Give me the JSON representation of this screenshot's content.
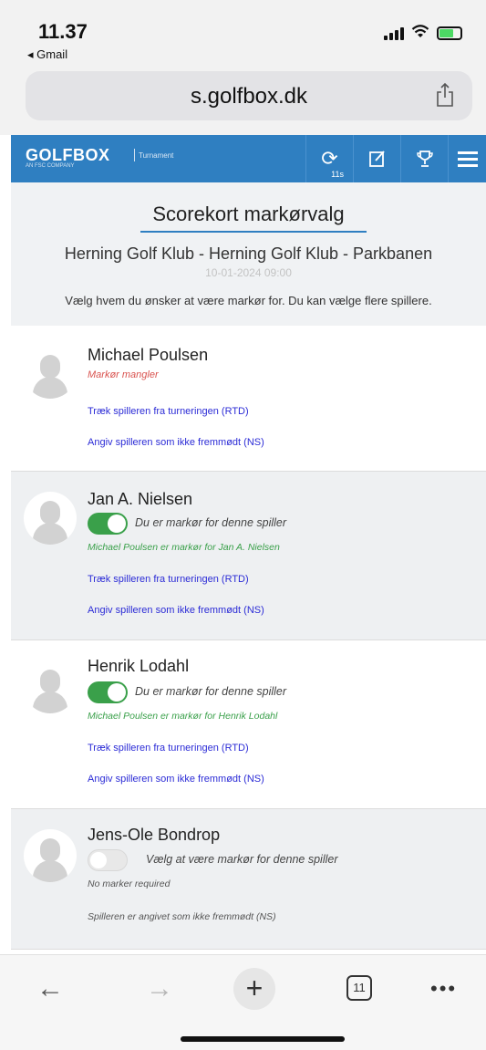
{
  "status": {
    "time": "11.37",
    "back_app": "◂ Gmail"
  },
  "browser": {
    "url": "s.golfbox.dk"
  },
  "header": {
    "logo": "GOLFBOX",
    "logo_sub": "AN FSC COMPANY",
    "tag": "Turnament",
    "sync_count": "11s"
  },
  "page": {
    "title": "Scorekort markørvalg",
    "club": "Herning Golf Klub - Herning Golf Klub - Parkbanen",
    "date": "10-01-2024 09:00",
    "hint": "Vælg hvem du ønsker at være markør for. Du kan vælge flere spillere."
  },
  "players": [
    {
      "name": "Michael Poulsen",
      "status": "Markør mangler",
      "link_rtd": "Træk spilleren fra turneringen (RTD)",
      "link_ns": "Angiv spilleren som ikke fremmødt (NS)"
    },
    {
      "name": "Jan A. Nielsen",
      "toggle_on": true,
      "toggle_label": "Du er markør for denne spiller",
      "marker_info": "Michael Poulsen er markør for Jan A. Nielsen",
      "link_rtd": "Træk spilleren fra turneringen (RTD)",
      "link_ns": "Angiv spilleren som ikke fremmødt (NS)"
    },
    {
      "name": "Henrik Lodahl",
      "toggle_on": true,
      "toggle_label": "Du er markør for denne spiller",
      "marker_info": "Michael Poulsen er markør for Henrik Lodahl",
      "link_rtd": "Træk spilleren fra turneringen (RTD)",
      "link_ns": "Angiv spilleren som ikke fremmødt (NS)"
    },
    {
      "name": "Jens-Ole Bondrop",
      "toggle_on": false,
      "toggle_label": "Vælg at være markør for denne spiller",
      "note": "No marker required",
      "ns_note": "Spilleren er angivet som ikke fremmødt (NS)"
    }
  ],
  "toolbar": {
    "back": "←",
    "forward": "→",
    "new_tab": "+",
    "tab_count": "11",
    "more": "•••"
  },
  "colors": {
    "brand_blue": "#2f7fc1",
    "toggle_green": "#3aa04a",
    "missing_red": "#d9534f",
    "link_blue": "#2b2bd6"
  }
}
